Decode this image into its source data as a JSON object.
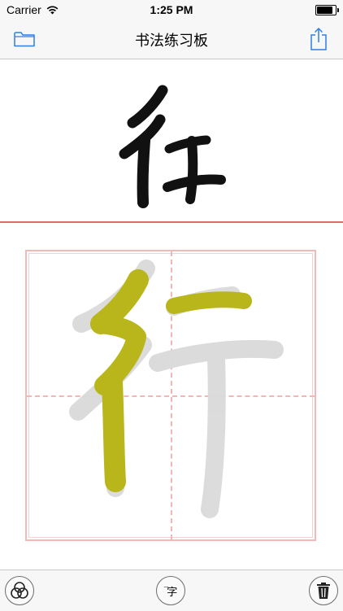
{
  "status_bar": {
    "carrier": "Carrier",
    "time": "1:25 PM",
    "battery_level": 0.95
  },
  "nav": {
    "title": "书法练习板",
    "left_icon": "folder-icon",
    "right_icon": "share-icon",
    "accent_color": "#2e7ee5"
  },
  "model_character": {
    "icon": "calligraphy-character-xing-icon",
    "ink_color": "#111111"
  },
  "practice": {
    "trace_color": "#b8b61a",
    "guide_color": "#d8d8d8",
    "grid_color": "#f2b6b6",
    "divider_color": "#e06b6b"
  },
  "toolbar": {
    "left_icon": "brush-color-circles-icon",
    "center_label": "字",
    "center_icon": "character-select-icon",
    "right_icon": "trash-icon"
  }
}
